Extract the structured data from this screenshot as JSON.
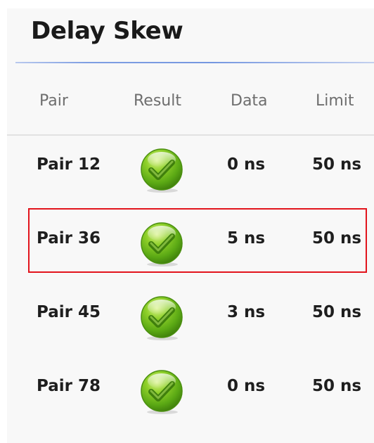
{
  "panel": {
    "title": "Delay Skew"
  },
  "table": {
    "headers": {
      "pair": "Pair",
      "result": "Result",
      "data": "Data",
      "limit": "Limit"
    },
    "rows": [
      {
        "pair": "Pair 12",
        "result": "pass",
        "data": "0 ns",
        "limit": "50 ns"
      },
      {
        "pair": "Pair 36",
        "result": "pass",
        "data": "5 ns",
        "limit": "50 ns",
        "selected": true
      },
      {
        "pair": "Pair 45",
        "result": "pass",
        "data": "3 ns",
        "limit": "50 ns"
      },
      {
        "pair": "Pair 78",
        "result": "pass",
        "data": "0 ns",
        "limit": "50 ns"
      }
    ]
  },
  "icons": {
    "pass": "checkmark-icon"
  },
  "colors": {
    "pass_green": "#6cbf1c",
    "selection_outline": "#e2141c",
    "title_rule": "#7597e0"
  }
}
